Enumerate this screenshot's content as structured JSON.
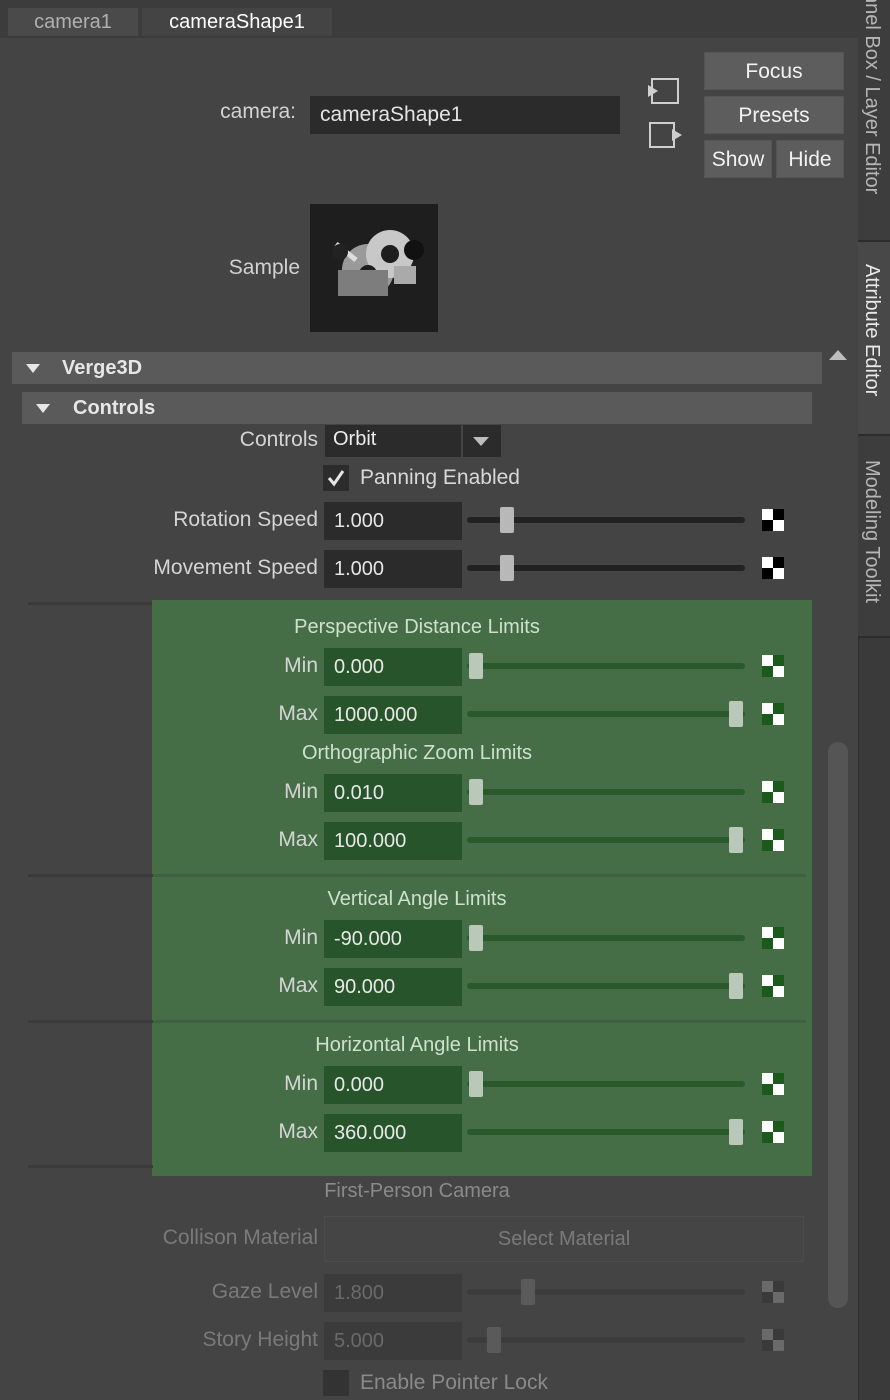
{
  "tabs": [
    {
      "label": "camera1",
      "active": false
    },
    {
      "label": "cameraShape1",
      "active": true
    }
  ],
  "side_tabs": [
    {
      "label": "nnel Box / Layer Editor",
      "active": false
    },
    {
      "label": "Attribute Editor",
      "active": true
    },
    {
      "label": "Modeling Toolkit",
      "active": false
    }
  ],
  "header": {
    "camera_label": "camera:",
    "camera_value": "cameraShape1",
    "focus_label": "Focus",
    "presets_label": "Presets",
    "show_label": "Show",
    "hide_label": "Hide",
    "sample_label": "Sample",
    "sample_icon": "camera-swatch-icon"
  },
  "sections": {
    "verge3d": "Verge3D",
    "controls": "Controls"
  },
  "controls": {
    "controls_label": "Controls",
    "controls_value": "Orbit",
    "panning_label": "Panning Enabled",
    "panning_checked": true,
    "rotation_label": "Rotation Speed",
    "rotation_value": "1.000",
    "rotation_pos": 0.12,
    "movement_label": "Movement Speed",
    "movement_value": "1.000",
    "movement_pos": 0.12
  },
  "limits": {
    "perspective_title": "Perspective Distance Limits",
    "persp_min_label": "Min",
    "persp_min_value": "0.000",
    "persp_min_pos": 0.0,
    "persp_max_label": "Max",
    "persp_max_value": "1000.000",
    "persp_max_pos": 1.0,
    "ortho_title": "Orthographic Zoom Limits",
    "ortho_min_label": "Min",
    "ortho_min_value": "0.010",
    "ortho_min_pos": 0.0,
    "ortho_max_label": "Max",
    "ortho_max_value": "100.000",
    "ortho_max_pos": 1.0,
    "vertical_title": "Vertical Angle Limits",
    "vert_min_label": "Min",
    "vert_min_value": "-90.000",
    "vert_min_pos": 0.0,
    "vert_max_label": "Max",
    "vert_max_value": "90.000",
    "vert_max_pos": 1.0,
    "horizontal_title": "Horizontal Angle Limits",
    "horiz_min_label": "Min",
    "horiz_min_value": "0.000",
    "horiz_min_pos": 0.0,
    "horiz_max_label": "Max",
    "horiz_max_value": "360.000",
    "horiz_max_pos": 1.0
  },
  "first_person": {
    "title": "First-Person Camera",
    "collision_label": "Collison Material",
    "select_material": "Select Material",
    "gaze_label": "Gaze Level",
    "gaze_value": "1.800",
    "gaze_pos": 0.2,
    "story_label": "Story Height",
    "story_value": "5.000",
    "story_pos": 0.07,
    "pointer_lock_label": "Enable Pointer Lock",
    "pointer_lock_checked": false
  },
  "colors": {
    "highlight_green": "#466e46",
    "background": "#444444"
  }
}
